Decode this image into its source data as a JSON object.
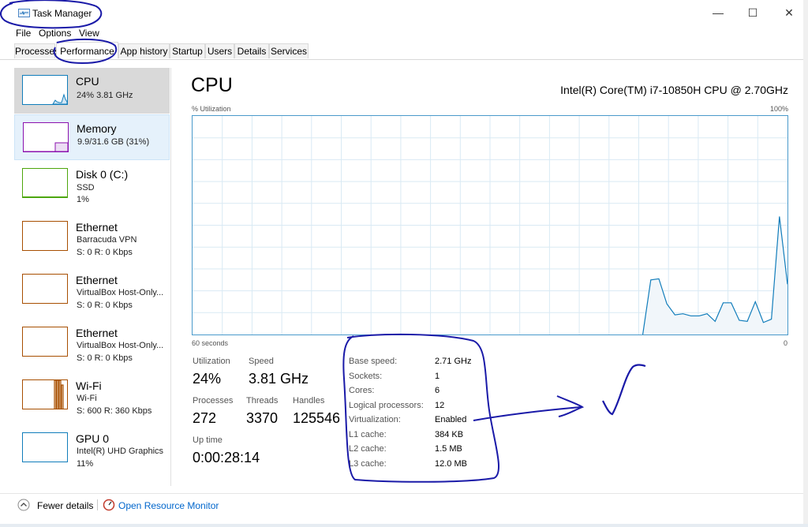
{
  "window": {
    "title": "Task Manager",
    "minimize_glyph": "—",
    "maximize_glyph": "☐",
    "close_glyph": "✕"
  },
  "menu": [
    "File",
    "Options",
    "View"
  ],
  "tabs": [
    {
      "label": "Processes",
      "active": false
    },
    {
      "label": "Performance",
      "active": true
    },
    {
      "label": "App history",
      "active": false
    },
    {
      "label": "Startup",
      "active": false
    },
    {
      "label": "Users",
      "active": false
    },
    {
      "label": "Details",
      "active": false
    },
    {
      "label": "Services",
      "active": false
    }
  ],
  "sidebar": {
    "items": [
      {
        "name": "CPU",
        "line1": "24%  3.81 GHz",
        "line2": "",
        "color": "#117dbb",
        "state": "selected"
      },
      {
        "name": "Memory",
        "line1": "9.9/31.6 GB (31%)",
        "line2": "",
        "color": "#8b12ae",
        "state": "hover"
      },
      {
        "name": "Disk 0 (C:)",
        "line1": "SSD",
        "line2": "1%",
        "color": "#4da60c",
        "state": ""
      },
      {
        "name": "Ethernet",
        "line1": "Barracuda VPN",
        "line2": "S: 0  R: 0 Kbps",
        "color": "#a74f01",
        "state": ""
      },
      {
        "name": "Ethernet",
        "line1": "VirtualBox Host-Only...",
        "line2": "S: 0  R: 0 Kbps",
        "color": "#a74f01",
        "state": ""
      },
      {
        "name": "Ethernet",
        "line1": "VirtualBox Host-Only...",
        "line2": "S: 0  R: 0 Kbps",
        "color": "#a74f01",
        "state": ""
      },
      {
        "name": "Wi-Fi",
        "line1": "Wi-Fi",
        "line2": "S: 600  R: 360 Kbps",
        "color": "#a74f01",
        "state": ""
      },
      {
        "name": "GPU 0",
        "line1": "Intel(R) UHD Graphics",
        "line2": "11%",
        "color": "#117dbb",
        "state": ""
      }
    ]
  },
  "panel": {
    "title": "CPU",
    "model": "Intel(R) Core(TM) i7-10850H CPU @ 2.70GHz",
    "graph_label": "% Utilization",
    "graph_max": "100%",
    "x_label_left": "60 seconds",
    "x_label_right": "0",
    "stats": {
      "utilization_label": "Utilization",
      "utilization": "24%",
      "speed_label": "Speed",
      "speed": "3.81 GHz",
      "processes_label": "Processes",
      "processes": "272",
      "threads_label": "Threads",
      "threads": "3370",
      "handles_label": "Handles",
      "handles": "125546",
      "uptime_label": "Up time",
      "uptime": "0:00:28:14"
    },
    "specs": [
      {
        "label": "Base speed:",
        "value": "2.71 GHz"
      },
      {
        "label": "Sockets:",
        "value": "1"
      },
      {
        "label": "Cores:",
        "value": "6"
      },
      {
        "label": "Logical processors:",
        "value": "12"
      },
      {
        "label": "Virtualization:",
        "value": "Enabled"
      },
      {
        "label": "L1 cache:",
        "value": "384 KB"
      },
      {
        "label": "L2 cache:",
        "value": "1.5 MB"
      },
      {
        "label": "L3 cache:",
        "value": "12.0 MB"
      }
    ],
    "utilization_series": [
      0,
      0,
      0,
      0,
      0,
      0,
      0,
      0,
      0,
      0,
      0,
      0,
      0,
      0,
      0,
      0,
      0,
      0,
      0,
      0,
      0,
      0,
      0,
      0,
      0,
      0,
      0,
      0,
      0,
      0,
      0,
      0,
      0,
      0,
      0,
      0,
      0,
      0,
      0,
      0,
      0,
      0,
      0,
      0,
      0,
      0,
      0,
      0,
      0,
      0,
      0,
      0,
      0,
      0,
      0,
      0,
      0,
      25,
      25.5,
      14,
      9,
      9.5,
      8.5,
      8.5,
      9.5,
      6,
      14.5,
      14.5,
      6.5,
      6,
      15,
      5.5,
      7,
      54,
      23
    ]
  },
  "footer": {
    "fewer_details": "Fewer details",
    "open_monitor": "Open Resource Monitor"
  },
  "colors": {
    "accent": "#117dbb",
    "graph_fill": "#f1f6fa",
    "ink": "#1a1aa8"
  }
}
